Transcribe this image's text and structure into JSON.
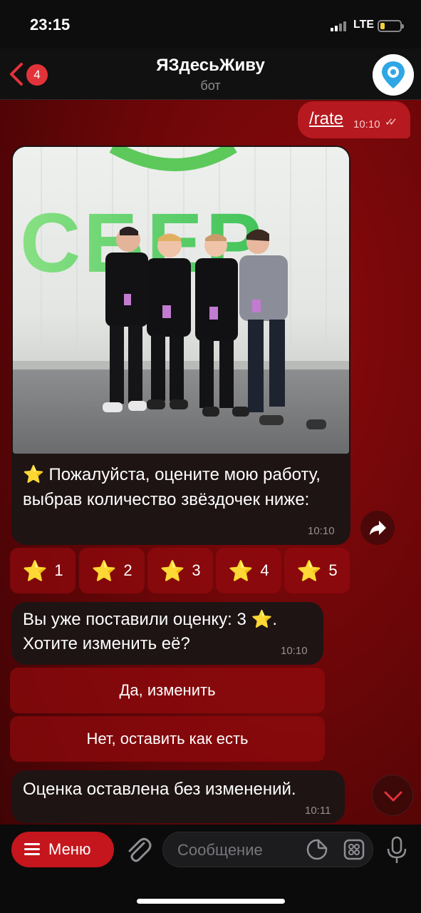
{
  "status_bar": {
    "time": "23:15",
    "network": "LTE"
  },
  "header": {
    "back_badge": "4",
    "title": "ЯЗдесьЖиву",
    "subtitle": "бот",
    "avatar_icon": "map-pin-icon"
  },
  "messages": {
    "outgoing_command": {
      "text": "/rate",
      "time": "10:10"
    },
    "photo_message": {
      "photo_sign": "СБЕР",
      "caption": "⭐ Пожалуйста, оцените мою работу, выбрав количество звёздочек ниже:",
      "time": "10:10"
    },
    "rating_buttons": [
      {
        "star": "⭐",
        "label": "1"
      },
      {
        "star": "⭐",
        "label": "2"
      },
      {
        "star": "⭐",
        "label": "3"
      },
      {
        "star": "⭐",
        "label": "4"
      },
      {
        "star": "⭐",
        "label": "5"
      }
    ],
    "already_rated": {
      "line1": "Вы уже поставили оценку: 3 ⭐.",
      "line2": "Хотите изменить её?",
      "time": "10:10"
    },
    "confirm_buttons": {
      "yes": "Да, изменить",
      "no": "Нет, оставить как есть"
    },
    "final_message": {
      "text": "Оценка оставлена без изменений.",
      "time": "10:11"
    }
  },
  "input_bar": {
    "menu_label": "Меню",
    "placeholder": "Сообщение"
  },
  "colors": {
    "accent": "#c4161c",
    "chat_bg": "#6a0608",
    "bubble_in": "#1e1414"
  }
}
